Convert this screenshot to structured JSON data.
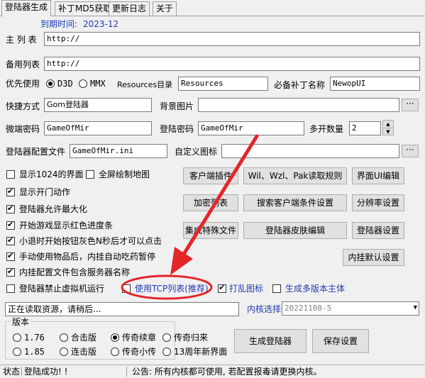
{
  "tabs": [
    "登陆器生成",
    "补丁MD5获取",
    "更新日志",
    "关于"
  ],
  "expire": {
    "label": "到期时间:",
    "value": "2023-12"
  },
  "main_list": {
    "label": "主 列 表",
    "value": "http://"
  },
  "backup_list": {
    "label": "备用列表",
    "value": "http://"
  },
  "priority": {
    "label": "优先使用",
    "options": [
      "D3D",
      "MMX"
    ],
    "selected": "D3D"
  },
  "resources": {
    "label": "Resources目录",
    "value": "Resources"
  },
  "required_patch": {
    "label": "必备补丁名称",
    "value": "NewopUI"
  },
  "shortcut": {
    "label": "快捷方式",
    "value": "Gom登陆器"
  },
  "bg_image": {
    "label": "背景图片",
    "value": "",
    "browse": "···"
  },
  "micro_pwd": {
    "label": "微端密码",
    "value": "GameOfMir"
  },
  "login_pwd": {
    "label": "登陆密码",
    "value": "GameOfMir"
  },
  "multi_open": {
    "label": "多开数量",
    "value": "2"
  },
  "config_file": {
    "label": "登陆器配置文件",
    "value": "GameOfMir.ini"
  },
  "custom_icon": {
    "label": "自定义图标",
    "value": "",
    "browse": "···"
  },
  "options": [
    {
      "label": "显示1024的界面",
      "checked": false
    },
    {
      "label": "全屏绘制地图",
      "checked": false
    },
    {
      "label": "显示开门动作",
      "checked": true
    },
    {
      "label": "登陆器允许最大化",
      "checked": true
    },
    {
      "label": "开始游戏显示红色进度条",
      "checked": true
    },
    {
      "label": "小退时开始按钮灰色N秒后才可以点击",
      "checked": true
    },
    {
      "label": "手动使用物品后，内挂自动吃药暂停",
      "checked": true
    },
    {
      "label": "内挂配置文件包含服务器名称",
      "checked": true
    },
    {
      "label": "登陆器禁止虚拟机运行",
      "checked": false
    },
    {
      "label": "使用TCP列表(推荐)",
      "checked": false
    },
    {
      "label": "打乱图标",
      "checked": true
    },
    {
      "label": "生成多版本主体",
      "checked": false
    }
  ],
  "buttons": {
    "client_plugin": "客户端插件",
    "wil_rules": "Wil、Wzl、Pak读取规则",
    "ui_edit": "界面UI编辑",
    "add_list": "加密列表",
    "search_client": "搜索客户端条件设置",
    "resolution": "分辨率设置",
    "special_files": "集成特殊文件",
    "skin_edit": "登陆器皮肤编辑",
    "launcher_settings": "登陆器设置",
    "plugin_default": "内挂默认设置",
    "generate": "生成登陆器",
    "save": "保存设置"
  },
  "loading": "正在读取资源，请稍后...",
  "kernel": {
    "label": "内核选择",
    "value": "20221108-5"
  },
  "version": {
    "title": "版本",
    "options": [
      "1.76",
      "1.85",
      "合击版",
      "连击版",
      "传奇续章",
      "传奇小传",
      "传奇归来",
      "13周年新界面"
    ],
    "selected": "传奇续章"
  },
  "status": {
    "label": "状态",
    "message": "登陆成功! !",
    "notice": "公告: 所有内核都可使用, 若配置报毒请更换内核。"
  }
}
